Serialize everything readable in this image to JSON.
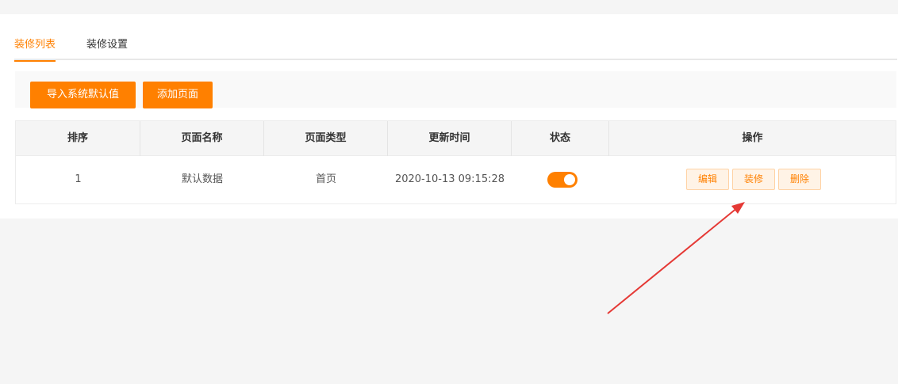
{
  "tabs": [
    {
      "label": "装修列表",
      "active": true
    },
    {
      "label": "装修设置",
      "active": false
    }
  ],
  "toolbar": {
    "import_label": "导入系统默认值",
    "add_label": "添加页面"
  },
  "table": {
    "columns": [
      "排序",
      "页面名称",
      "页面类型",
      "更新时间",
      "状态",
      "操作"
    ],
    "rows": [
      {
        "order": "1",
        "name": "默认数据",
        "type": "首页",
        "updated": "2020-10-13 09:15:28",
        "status_on": true,
        "actions": [
          "编辑",
          "装修",
          "删除"
        ]
      }
    ]
  },
  "colors": {
    "accent": "#ff8000",
    "arrow": "#e53935"
  }
}
